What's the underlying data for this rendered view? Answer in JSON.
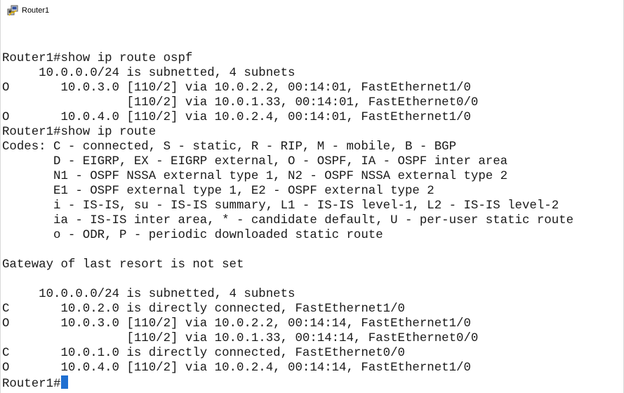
{
  "window": {
    "title": "Router1",
    "icon": "putty-icon"
  },
  "terminal": {
    "lines": [
      "",
      "Router1#show ip route ospf",
      "     10.0.0.0/24 is subnetted, 4 subnets",
      "O       10.0.3.0 [110/2] via 10.0.2.2, 00:14:01, FastEthernet1/0",
      "                 [110/2] via 10.0.1.33, 00:14:01, FastEthernet0/0",
      "O       10.0.4.0 [110/2] via 10.0.2.4, 00:14:01, FastEthernet1/0",
      "Router1#show ip route",
      "Codes: C - connected, S - static, R - RIP, M - mobile, B - BGP",
      "       D - EIGRP, EX - EIGRP external, O - OSPF, IA - OSPF inter area",
      "       N1 - OSPF NSSA external type 1, N2 - OSPF NSSA external type 2",
      "       E1 - OSPF external type 1, E2 - OSPF external type 2",
      "       i - IS-IS, su - IS-IS summary, L1 - IS-IS level-1, L2 - IS-IS level-2",
      "       ia - IS-IS inter area, * - candidate default, U - per-user static route",
      "       o - ODR, P - periodic downloaded static route",
      "",
      "Gateway of last resort is not set",
      "",
      "     10.0.0.0/24 is subnetted, 4 subnets",
      "C       10.0.2.0 is directly connected, FastEthernet1/0",
      "O       10.0.3.0 [110/2] via 10.0.2.2, 00:14:14, FastEthernet1/0",
      "                 [110/2] via 10.0.1.33, 00:14:14, FastEthernet0/0",
      "C       10.0.1.0 is directly connected, FastEthernet0/0",
      "O       10.0.4.0 [110/2] via 10.0.2.4, 00:14:14, FastEthernet1/0"
    ],
    "prompt": "Router1#",
    "cursor_color": "#1f6fd1"
  }
}
